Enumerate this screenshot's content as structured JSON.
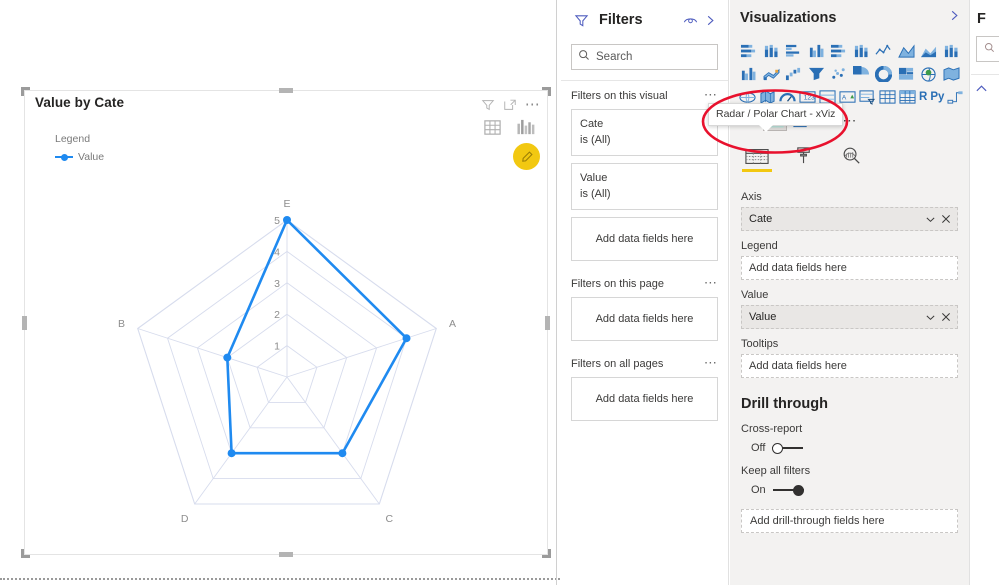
{
  "canvas": {
    "visual": {
      "title": "Value by Cate",
      "legend": {
        "title": "Legend",
        "series_label": "Value"
      },
      "header_icons": [
        "filter-icon",
        "focus-mode-icon",
        "more-options-icon",
        "table-view-icon",
        "chart-view-icon",
        "edit-pencil-icon"
      ]
    }
  },
  "chart_data": {
    "type": "radar",
    "title": "Value by Cate",
    "categories": [
      "A",
      "B",
      "C",
      "D",
      "E"
    ],
    "axis_order_clockwise_from_top": [
      "E",
      "A",
      "C",
      "D",
      "B"
    ],
    "series": [
      {
        "name": "Value",
        "color": "#1f8af0",
        "values": [
          4,
          2,
          3,
          3,
          5
        ]
      }
    ],
    "radial_ticks": [
      1,
      2,
      3,
      4,
      5
    ],
    "tick_labels": [
      "1",
      "2",
      "3",
      "4",
      "5"
    ],
    "rlim": [
      0,
      5
    ],
    "rings": 5,
    "grid": true,
    "grid_color": "#d7dced",
    "legend": {
      "title": "Legend",
      "entries": [
        "Value"
      ],
      "position": "top-left"
    },
    "xlabel": "",
    "ylabel": ""
  },
  "filters_pane": {
    "title": "Filters",
    "head_icons": [
      "hide-pane-icon",
      "collapse-chevron-icon"
    ],
    "search": {
      "placeholder": "Search",
      "value": "",
      "label": "Search"
    },
    "sections": [
      {
        "title": "Filters on this visual",
        "cards": [
          {
            "field": "Cate",
            "condition": "is (All)"
          },
          {
            "field": "Value",
            "condition": "is (All)"
          }
        ],
        "drop_label": "Add data fields here"
      },
      {
        "title": "Filters on this page",
        "cards": [],
        "drop_label": "Add data fields here"
      },
      {
        "title": "Filters on all pages",
        "cards": [],
        "drop_label": "Add data fields here"
      }
    ]
  },
  "viz_pane": {
    "title": "Visualizations",
    "collapse_icon": "chevron-right-icon",
    "gallery": {
      "rows": [
        [
          "stacked-bar-chart-icon",
          "stacked-column-chart-icon",
          "clustered-bar-chart-icon",
          "clustered-column-chart-icon",
          "hundred-percent-stacked-bar-icon",
          "hundred-percent-stacked-column-icon",
          "line-chart-icon",
          "area-chart-icon",
          "stacked-area-chart-icon",
          "line-and-stacked-column-icon"
        ],
        [
          "line-and-clustered-column-icon",
          "ribbon-chart-icon",
          "waterfall-chart-icon",
          "funnel-chart-icon",
          "scatter-chart-icon",
          "pie-chart-icon",
          "donut-chart-icon",
          "treemap-icon",
          "map-icon",
          "filled-map-icon"
        ],
        [
          "azure-map-icon",
          "shape-map-icon",
          "gauge-icon",
          "card-icon",
          "multi-row-card-icon",
          "kpi-icon",
          "slicer-icon",
          "table-icon",
          "matrix-icon",
          "r-script-visual-icon",
          "python-visual-icon",
          "decomposition-tree-icon"
        ],
        [
          "key-influencers-icon",
          "radar-polar-chart-xviz-icon",
          "paginated-report-icon",
          "get-more-visuals-icon"
        ]
      ],
      "selected": "radar-polar-chart-xviz-icon",
      "r_label": "R",
      "py_label": "Py"
    },
    "tooltip": "Radar / Polar Chart - xViz",
    "format_tabs": [
      {
        "name": "fields-tab",
        "icon": "fields-table-icon",
        "active": true
      },
      {
        "name": "format-tab",
        "icon": "paint-roller-icon",
        "active": false
      },
      {
        "name": "analytics-tab",
        "icon": "magnifier-analytics-icon",
        "active": false
      }
    ],
    "wells": [
      {
        "label": "Axis",
        "value": "Cate",
        "filled": true,
        "chevron": "chevron-down-icon",
        "remove": "close-icon"
      },
      {
        "label": "Legend",
        "value": "Add data fields here",
        "filled": false
      },
      {
        "label": "Value",
        "value": "Value",
        "filled": true,
        "chevron": "chevron-down-icon",
        "remove": "close-icon"
      },
      {
        "label": "Tooltips",
        "value": "Add data fields here",
        "filled": false
      }
    ],
    "drill_through": {
      "title": "Drill through",
      "cross_report": {
        "label": "Cross-report",
        "state": "Off",
        "on": false
      },
      "keep_all_filters": {
        "label": "Keep all filters",
        "state": "On",
        "on": true
      },
      "drop_label": "Add drill-through fields here"
    }
  },
  "fields_pane": {
    "title": "F",
    "collapse_icon": "chevron-up-icon",
    "search_icon": "search-icon"
  },
  "annotation": {
    "shape": "red-ellipse-highlight",
    "color": "#e8112d"
  },
  "colors": {
    "series": "#1f8af0",
    "grid": "#d7dced",
    "accent_yellow": "#f2c811",
    "pane_bg": "#f3f2f1",
    "text": "#252423",
    "annotation_red": "#e8112d"
  }
}
